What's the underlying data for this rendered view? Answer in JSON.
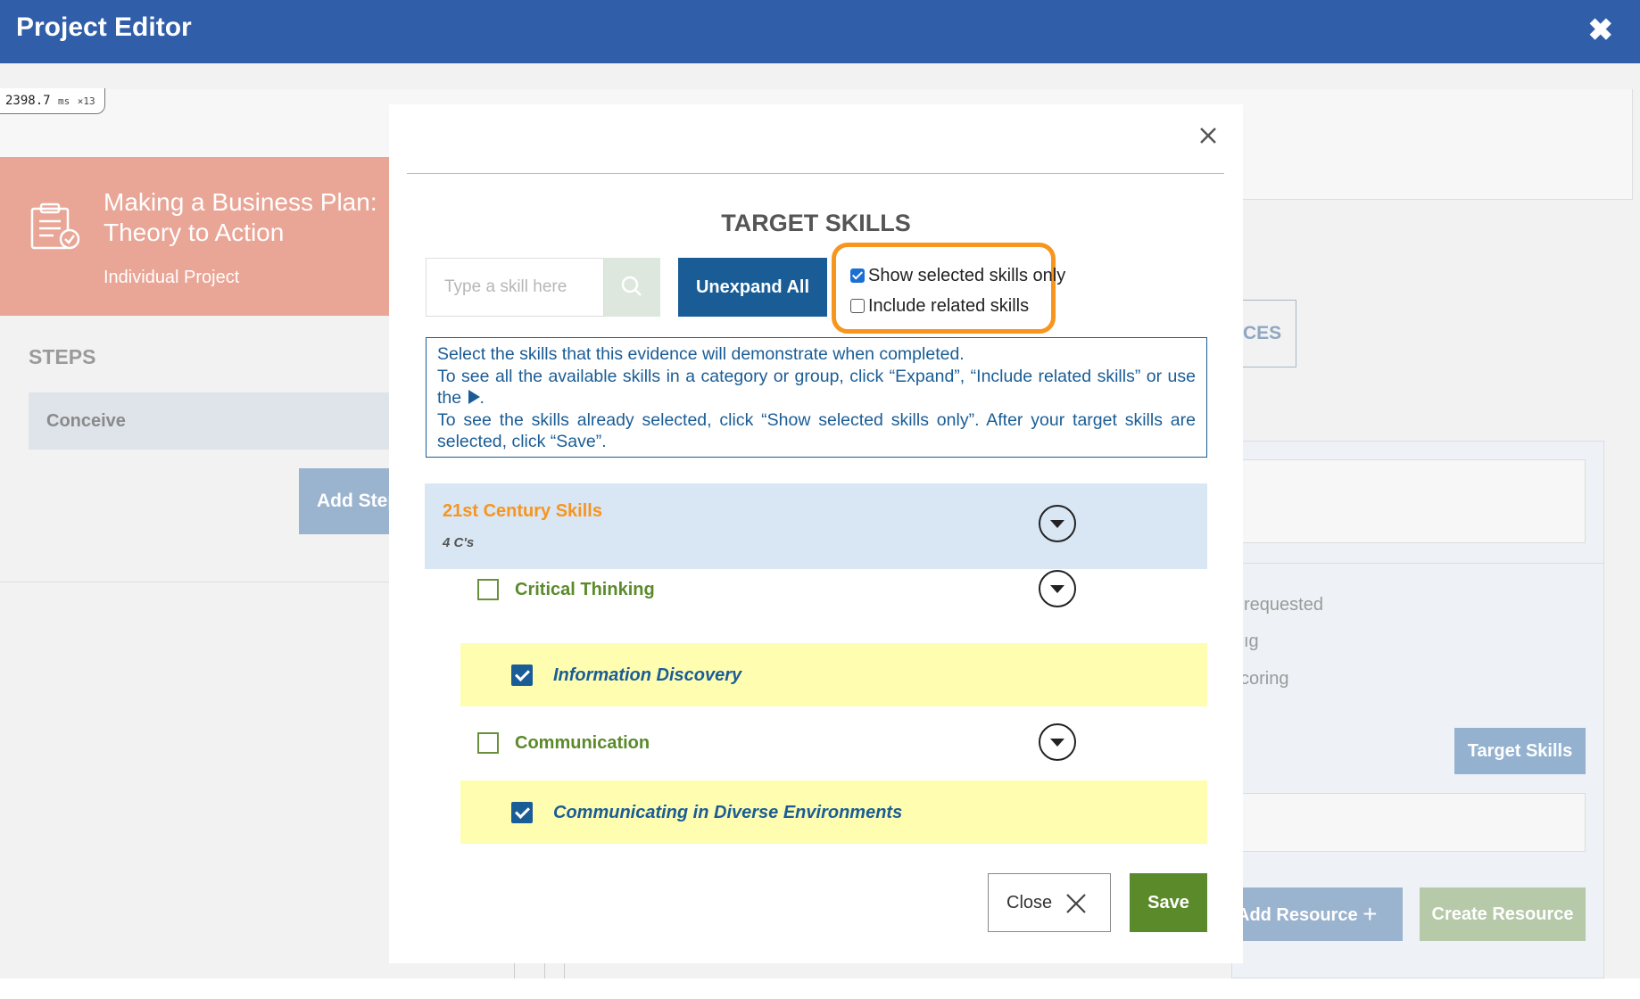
{
  "app": {
    "title": "Project Editor",
    "close_icon": "close-icon"
  },
  "timer": {
    "value": "2398.7",
    "unit": "ms",
    "count": "×13"
  },
  "project": {
    "title_line1": "Making a Business Plan:",
    "title_line2": "Theory to Action",
    "type": "Individual Project",
    "icon": "clipboard-check-icon"
  },
  "steps": {
    "label": "STEPS",
    "items": [
      "Conceive"
    ],
    "add_label": "Add Step"
  },
  "right_panel": {
    "tab_partial": "CES",
    "lines": [
      "requested",
      "ıg",
      "coring"
    ],
    "target_skills_button": "Target Skills",
    "add_resource_button": "Add Resource",
    "create_resource_button": "Create Resource"
  },
  "modal": {
    "title": "TARGET SKILLS",
    "search_placeholder": "Type a skill here",
    "unexpand_label": "Unexpand All",
    "show_selected_label": "Show selected skills only",
    "show_selected_checked": true,
    "include_related_label": "Include related skills",
    "include_related_checked": false,
    "info_line1": "Select the skills that this evidence will demonstrate when completed.",
    "info_line2a": "To see all the available skills in a category or group, click “Expand”, “Include related skills” or use the",
    "info_line2b": ".",
    "info_line3": "To see the skills already selected, click “Show selected skills only”. After your target skills are selected, click “Save”.",
    "category": {
      "title": "21st Century Skills",
      "subtitle": "4 C's"
    },
    "skills": [
      {
        "label": "Critical Thinking",
        "checked": false,
        "level": "group"
      },
      {
        "label": "Information Discovery",
        "checked": true,
        "level": "skill"
      },
      {
        "label": "Communication",
        "checked": false,
        "level": "group"
      },
      {
        "label": "Communicating in Diverse Environments",
        "checked": true,
        "level": "skill"
      }
    ],
    "close_label": "Close",
    "save_label": "Save"
  },
  "colors": {
    "header_blue": "#305ea8",
    "accent_orange": "#f7951e",
    "primary_blue": "#1a5d96",
    "green": "#5b8a2a",
    "selected_bg": "#fffdb0"
  }
}
